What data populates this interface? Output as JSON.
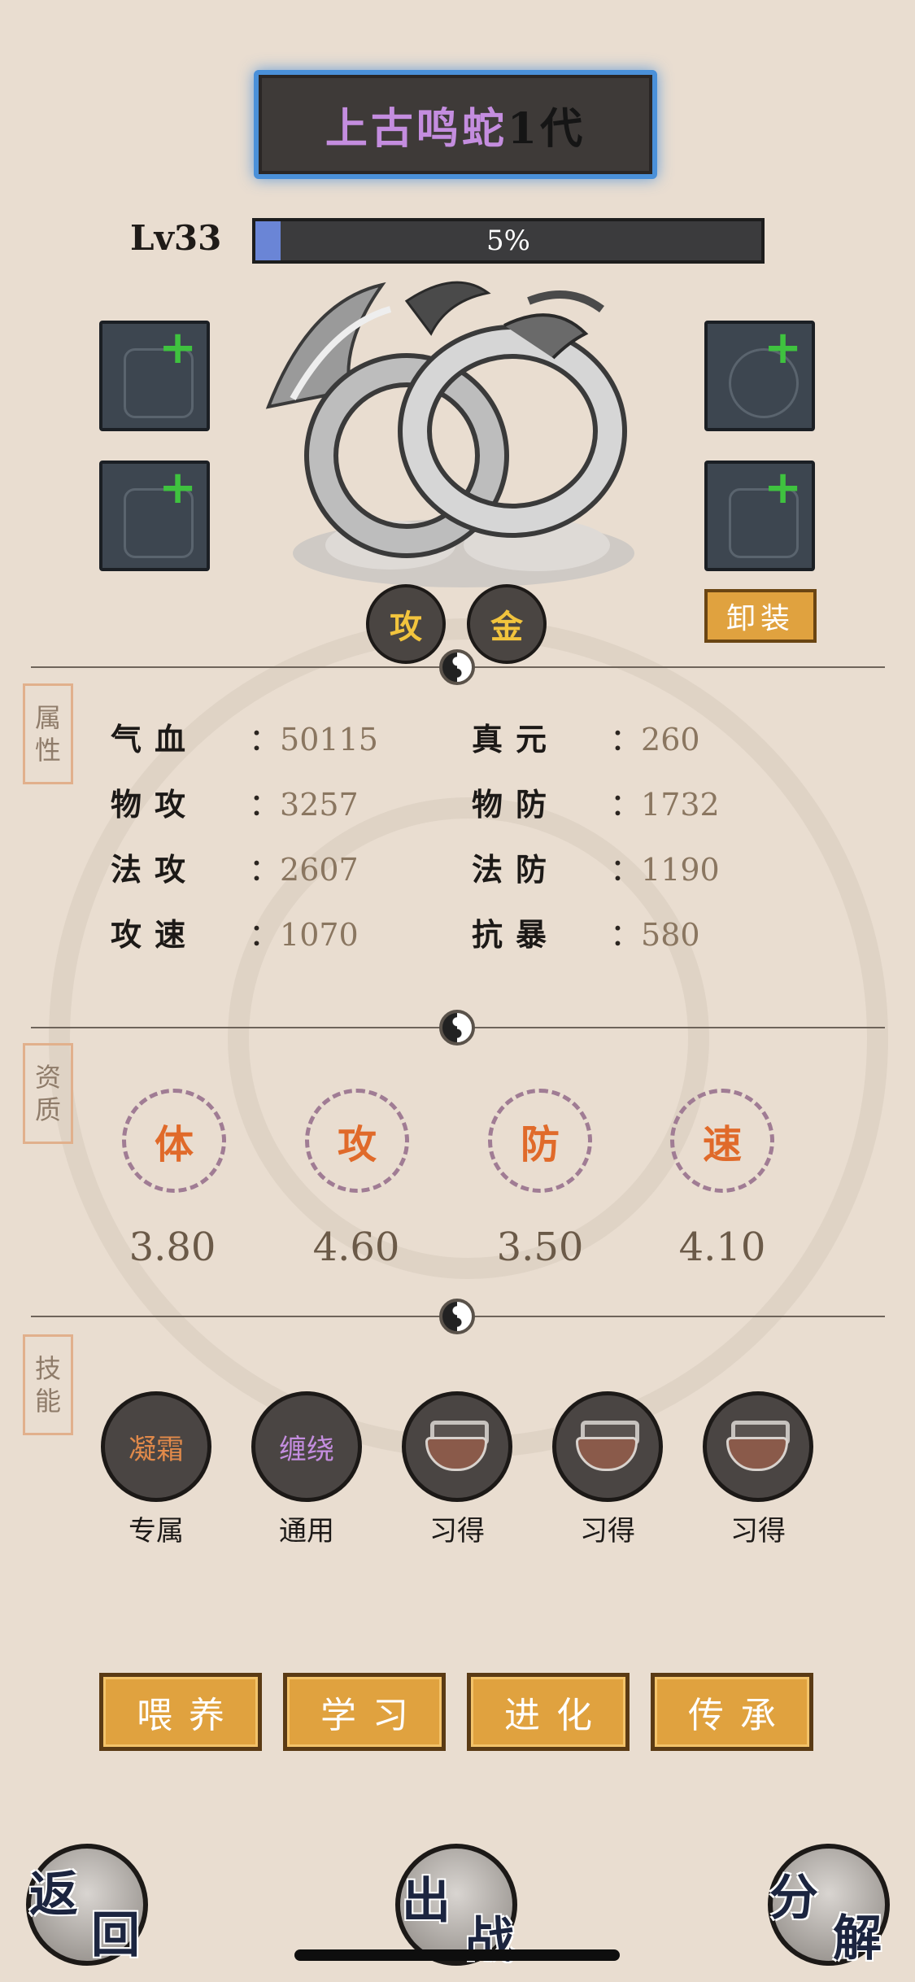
{
  "pet": {
    "name": "上古鸣蛇",
    "generation": "1代",
    "level": "Lv33",
    "exp_percent": 5,
    "exp_text": "5%",
    "tags": [
      "攻",
      "金"
    ],
    "unequip_label": "卸装"
  },
  "sections": {
    "attributes": [
      "属",
      "性"
    ],
    "aptitude": [
      "资",
      "质"
    ],
    "skills": [
      "技",
      "能"
    ]
  },
  "stats": [
    {
      "label": "气血",
      "value": "50115"
    },
    {
      "label": "真元",
      "value": "260"
    },
    {
      "label": "物攻",
      "value": "3257"
    },
    {
      "label": "物防",
      "value": "1732"
    },
    {
      "label": "法攻",
      "value": "2607"
    },
    {
      "label": "法防",
      "value": "1190"
    },
    {
      "label": "攻速",
      "value": "1070"
    },
    {
      "label": "抗暴",
      "value": "580"
    }
  ],
  "aptitudes": [
    {
      "label": "体",
      "value": "3.80"
    },
    {
      "label": "攻",
      "value": "4.60"
    },
    {
      "label": "防",
      "value": "3.50"
    },
    {
      "label": "速",
      "value": "4.10"
    }
  ],
  "skills": [
    {
      "name": "凝霜",
      "type": "专属",
      "color": "#e0894a"
    },
    {
      "name": "缠绕",
      "type": "通用",
      "color": "#c48ddf"
    },
    {
      "name": "",
      "type": "习得",
      "locked": true
    },
    {
      "name": "",
      "type": "习得",
      "locked": true
    },
    {
      "name": "",
      "type": "习得",
      "locked": true
    }
  ],
  "actions": [
    "喂养",
    "学习",
    "进化",
    "传承"
  ],
  "nav": {
    "back": [
      "返",
      "回"
    ],
    "battle": [
      "出",
      "战"
    ],
    "decompose": [
      "分",
      "解"
    ]
  },
  "colors": {
    "accent_orange": "#e0a23f",
    "pet_name_purple": "#c48ddf",
    "equip_plus_green": "#3fc23f"
  }
}
